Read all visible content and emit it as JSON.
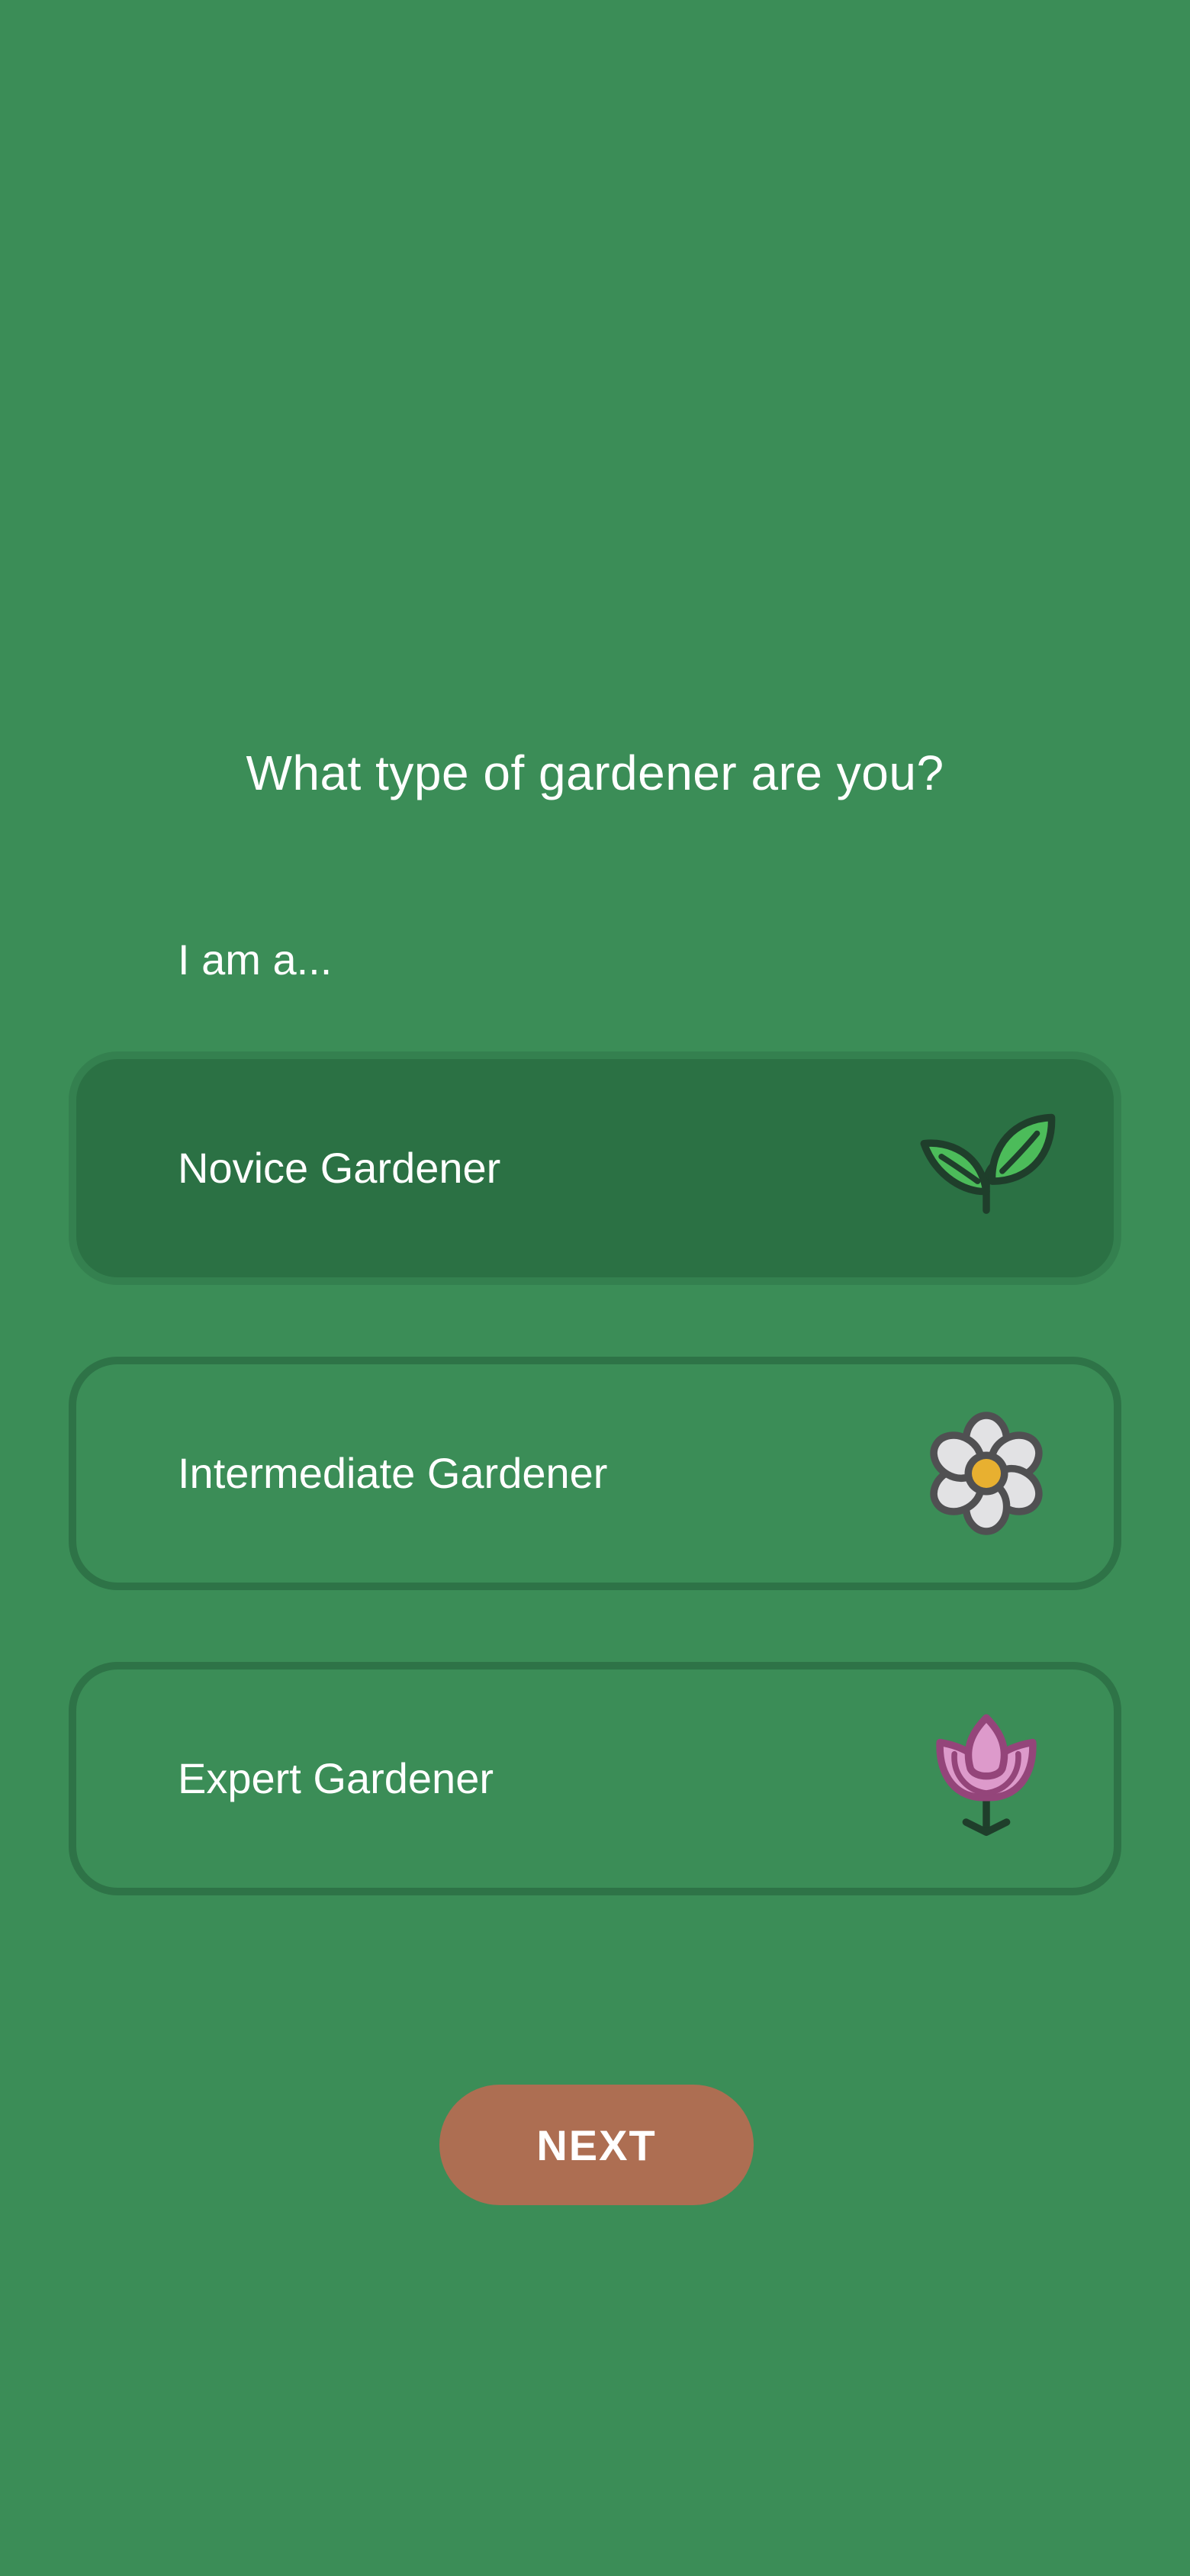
{
  "header": {
    "title": "What type of gardener are you?",
    "subtitle": "I am a..."
  },
  "options": [
    {
      "label": "Novice Gardener",
      "icon": "sprout-icon",
      "selected": true
    },
    {
      "label": "Intermediate Gardener",
      "icon": "daisy-flower-icon",
      "selected": false
    },
    {
      "label": "Expert Gardener",
      "icon": "tulip-icon",
      "selected": false
    }
  ],
  "footer": {
    "next_label": "NEXT"
  },
  "colors": {
    "background": "#3b8d57",
    "selected_card": "#2b7144",
    "card_border": "#2e7347",
    "next_button": "#ad6e52",
    "sprout_leaf": "#4cbc5a",
    "daisy_petal": "#e2e2e4",
    "daisy_center": "#e8b030",
    "tulip_petal": "#dd9acb",
    "tulip_outline": "#94457a"
  }
}
